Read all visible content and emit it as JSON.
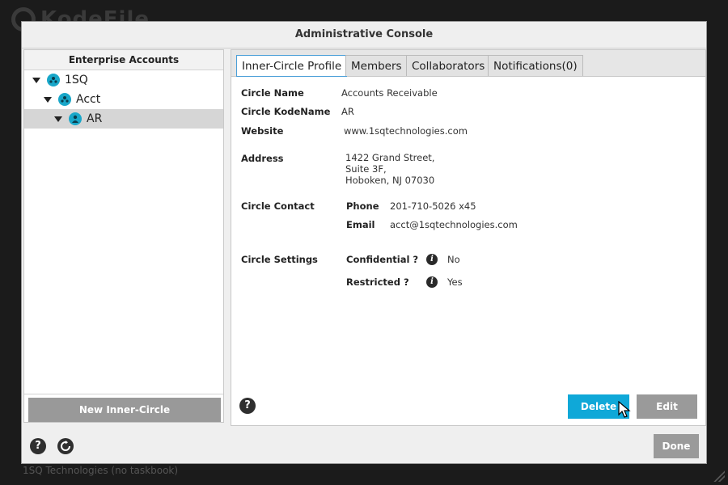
{
  "background": {
    "app_name": "KodeFile",
    "footer_text": "1SQ Technologies (no taskbook)"
  },
  "dialog": {
    "title": "Administrative Console"
  },
  "left_panel": {
    "header": "Enterprise Accounts",
    "tree": [
      {
        "label": "1SQ",
        "level": 0,
        "expanded": true
      },
      {
        "label": "Acct",
        "level": 1,
        "expanded": true
      },
      {
        "label": "AR",
        "level": 2,
        "expanded": true,
        "selected": true
      }
    ],
    "new_button_label": "New Inner-Circle"
  },
  "tabs": [
    {
      "label": "Inner-Circle Profile",
      "active": true
    },
    {
      "label": "Members",
      "active": false
    },
    {
      "label": "Collaborators",
      "active": false
    },
    {
      "label": "Notifications(0)",
      "active": false
    }
  ],
  "profile": {
    "circle_name_label": "Circle Name",
    "circle_name": "Accounts Receivable",
    "kodename_label": "Circle KodeName",
    "kodename": "AR",
    "website_label": "Website",
    "website": "www.1sqtechnologies.com",
    "address_label": "Address",
    "address_line1": "1422 Grand Street,",
    "address_line2": "Suite 3F,",
    "address_line3": "Hoboken, NJ 07030",
    "contact_label": "Circle Contact",
    "phone_label": "Phone",
    "phone": "201-710-5026 x45",
    "email_label": "Email",
    "email": "acct@1sqtechnologies.com",
    "settings_label": "Circle Settings",
    "confidential_label": "Confidential ?",
    "confidential_value": "No",
    "restricted_label": "Restricted ?",
    "restricted_value": "Yes"
  },
  "buttons": {
    "delete": "Delete",
    "edit": "Edit",
    "done": "Done"
  },
  "icons": {
    "help": "?",
    "info": "i"
  },
  "colors": {
    "accent": "#0fa8d8",
    "tree_icon": "#19a7c9",
    "secondary_button": "#9a9a9a"
  }
}
